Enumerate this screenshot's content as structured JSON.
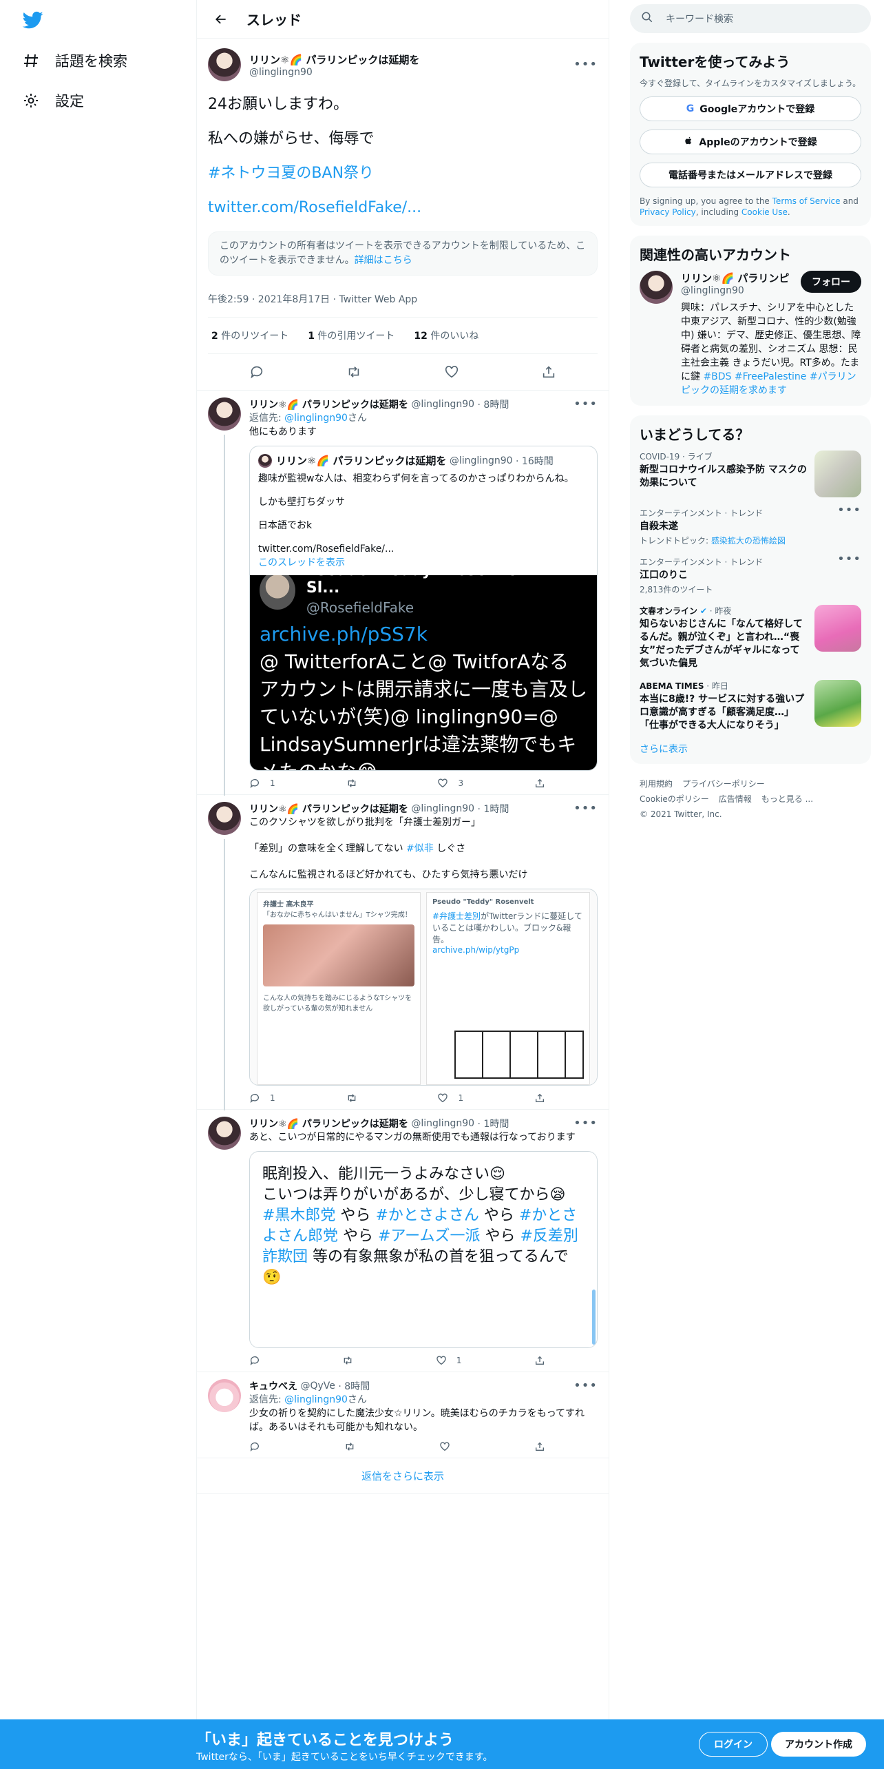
{
  "nav": {
    "explore_label": "話題を検索",
    "settings_label": "設定"
  },
  "header": {
    "title": "スレッド"
  },
  "main_tweet": {
    "display_name": "リリン⚛🌈 パラリンピックは延期を",
    "handle": "@linglingn90",
    "lines": [
      "24お願いしますわ。",
      "私への嫌がらせ、侮辱で",
      "#ネトウヨ夏のBAN祭り",
      "twitter.com/RosefieldFake/..."
    ],
    "notice_text": "このアカウントの所有者はツイートを表示できるアカウントを制限しているため、このツイートを表示できません。",
    "notice_link": "詳細はこちら",
    "meta": "午後2:59 · 2021年8月17日 · Twitter Web App",
    "retweets_count": "2",
    "retweets_label": "件のリツイート",
    "quotes_count": "1",
    "quotes_label": "件の引用ツイート",
    "likes_count": "12",
    "likes_label": "件のいいね"
  },
  "replies": [
    {
      "name": "リリン⚛🌈 パラリンピックは延期を",
      "handle": "@linglingn90",
      "time": "· 8時間",
      "reply_to_prefix": "返信先: ",
      "reply_to": "@linglingn90",
      "reply_to_suffix": "さん",
      "text": "他にもあります",
      "quote": {
        "name": "リリン⚛🌈 パラリンピックは延期を",
        "handle": "@linglingn90",
        "time": "· 16時間",
        "p1": "趣味が監視wな人は、相変わらず何を言ってるのかさっぱりわからんね。",
        "p2": "しかも壁打ちダッサ",
        "p3": "日本語でおk",
        "p4": "twitter.com/RosefieldFake/...",
        "thread_link": "このスレッドを表示",
        "img_name": "Pseudo \"Teddy\" Rosenvelt Anti-Sl...",
        "img_handle": "@RosefieldFake",
        "img_link": "archive.ph/pSS7k",
        "img_text": "@ TwitterforAこと@ TwitforAなるアカウントは開示請求に一度も言及していないが(笑)@ linglingn90=@ LindsaySumnerJrは違法薬物でもキメたのかな😂"
      },
      "replies_count": "1",
      "retweets_count": "",
      "likes_count": "3"
    },
    {
      "name": "リリン⚛🌈 パラリンピックは延期を",
      "handle": "@linglingn90",
      "time": "· 1時間",
      "text_a": "このクソシャツを欲しがり批判を「弁護士差別ガー」",
      "text_b1": "「差別」の意味を全く理解してない ",
      "text_b_tag": "#似非",
      "text_b2": " しぐさ",
      "text_c": "こんなんに監視されるほど好かれても、ひたすら気持ち悪いだけ",
      "shot_left_name": "弁護士 高木良平",
      "shot_left_text": "「おなかに赤ちゃんはいません」Tシャツ完成！",
      "shot_left_foot": "こんな人の気持ちを踏みにじるようなTシャツを欲しがっている輩の気が知れません",
      "shot_right_name": "Pseudo \"Teddy\" Rosenvelt",
      "shot_right_tag": "#弁護士差別",
      "shot_right_text": "がTwitterランドに蔓延していることは嘆かわしい。ブロック&報告。",
      "shot_right_link": "archive.ph/wip/ytgPp",
      "replies_count": "1",
      "retweets_count": "",
      "likes_count": "1"
    },
    {
      "name": "リリン⚛🌈 パラリンピックは延期を",
      "handle": "@linglingn90",
      "time": "· 1時間",
      "text": "あと、こいつが日常的にやるマンガの無断使用でも通報は行なっております",
      "img_l1": "眠剤投入、能川元一うよみなさい😌",
      "img_l2": "こいつは弄りがいがあるが、少し寝てから😪",
      "img_t1": "#黒木郎党",
      "img_y1": " やら ",
      "img_t2": "#かとさよさん",
      "img_y2": " やら ",
      "img_t3": "#かとさよさん郎党",
      "img_y3": " やら ",
      "img_t4": "#アームズ一派",
      "img_y4": " やら ",
      "img_t5": "#反差別詐欺団",
      "img_y5": " 等の有象無象が私の首を狙ってるんで🤨",
      "replies_count": "",
      "retweets_count": "",
      "likes_count": "1"
    },
    {
      "name": "キュウべえ",
      "handle": "@QyVe",
      "time": "· 8時間",
      "reply_to_prefix": "返信先: ",
      "reply_to": "@linglingn90",
      "reply_to_suffix": "さん",
      "text": "少女の祈りを契約にした魔法少女☆リリン。暁美ほむらのチカラをもってすれば。あるいはそれも可能かも知れない。"
    }
  ],
  "show_more_replies": "返信をさらに表示",
  "search": {
    "placeholder": "キーワード検索"
  },
  "signup": {
    "title": "Twitterを使ってみよう",
    "subtitle": "今すぐ登録して、タイムラインをカスタマイズしましょう。",
    "google": "Googleアカウントで登録",
    "apple": "Appleのアカウントで登録",
    "phone": "電話番号またはメールアドレスで登録",
    "terms_a": "By signing up, you agree to the ",
    "terms_tos": "Terms of Service",
    "terms_b": " and ",
    "terms_pp": "Privacy Policy",
    "terms_c": ", including ",
    "terms_cu": "Cookie Use",
    "terms_d": "."
  },
  "related": {
    "title": "関連性の高いアカウント",
    "name": "リリン⚛🌈 パラリンピ",
    "handle": "@linglingn90",
    "follow": "フォロー",
    "bio": "興味：パレスチナ、シリアを中心とした中東アジア、新型コロナ、性的少数(勉強中) 嫌い：デマ、歴史修正、優生思想、障碍者と病気の差別、シオニズム 思想：民主社会主義 きょうだい児。RT多め。たまに鍵 ",
    "bio_t1": "#BDS",
    "bio_t2": "#FreePalestine",
    "bio_t3": "#パラリンピックの延期を求めます"
  },
  "trends": {
    "title": "いまどうしてる？",
    "items": [
      {
        "cat": "COVID-19 · ライブ",
        "title": "新型コロナウイルス感染予防 マスクの効果について"
      },
      {
        "cat": "エンターテインメント · トレンド",
        "title": "自殺未遂",
        "sub_prefix": "トレンドトピック: ",
        "sub_link": "感染拡大の恐怖絵図"
      },
      {
        "cat": "エンターテインメント · トレンド",
        "title": "江口のりこ",
        "sub": "2,813件のツイート"
      },
      {
        "cat": "文春オンライン",
        "cat_time": "· 昨夜",
        "title": "知らないおじさんに「なんて格好してるんだ。親が泣くぞ」と言われ…“喪女”だったデブさんがギャルになって気づいた偏見"
      },
      {
        "cat": "ABEMA TIMES",
        "cat_time": "· 昨日",
        "title": "本当に8歳!? サービスに対する強いプロ意識が高すぎる「顧客満足度…」「仕事ができる大人になりそう」"
      }
    ],
    "show_more": "さらに表示"
  },
  "footer": {
    "terms": "利用規約",
    "privacy": "プライバシーポリシー",
    "cookie": "Cookieのポリシー",
    "ads": "広告情報",
    "more": "もっと見る ...",
    "copy": "© 2021 Twitter, Inc."
  },
  "bottom": {
    "title": "「いま」起きていることを見つけよう",
    "sub": "Twitterなら、「いま」起きていることをいち早くチェックできます。",
    "login": "ログイン",
    "signup": "アカウント作成"
  },
  "colors": {
    "accent": "#1d9bf0",
    "text": "#0f1419",
    "muted": "#536471"
  }
}
